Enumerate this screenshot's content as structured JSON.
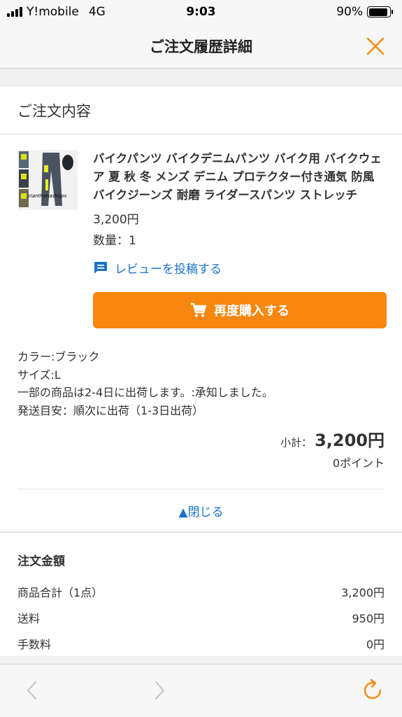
{
  "status": {
    "carrier": "Y!mobile",
    "network": "4G",
    "time": "9:03",
    "battery": "90%",
    "battery_level": 0.9
  },
  "header": {
    "title": "ご注文履歴詳細",
    "close_icon": "close-icon",
    "accent_color": "#f7870f"
  },
  "order": {
    "section_title": "ご注文内容",
    "product": {
      "thumbnail_text": "rianthenashops",
      "title": "バイクパンツ バイクデニムパンツ バイク用 バイクウェア 夏 秋 冬 メンズ デニム プロテクター付き通気 防風 バイクジーンズ 耐磨 ライダースパンツ ストレッチ",
      "price": "3,200円",
      "quantity": "数量：1",
      "review_label": "レビューを投稿する",
      "rebuy_label": "再度購入する"
    },
    "options": [
      "カラー:ブラック",
      "サイズ:L",
      "一部の商品は2-4日に出荷します。:承知しました。",
      "発送目安：順次に出荷（1-3日出荷）"
    ],
    "subtotal_label": "小計：",
    "subtotal_value": "3,200円",
    "points": "0ポイント",
    "collapse_label": "▲閉じる"
  },
  "totals": {
    "heading": "注文金額",
    "rows": [
      {
        "label": "商品合計（1点）",
        "value": "3,200円"
      },
      {
        "label": "送料",
        "value": "950円"
      },
      {
        "label": "手数料",
        "value": "0円"
      }
    ]
  },
  "toolbar": {
    "back_icon": "chevron-left-icon",
    "forward_icon": "chevron-right-icon",
    "reload_icon": "reload-icon"
  }
}
